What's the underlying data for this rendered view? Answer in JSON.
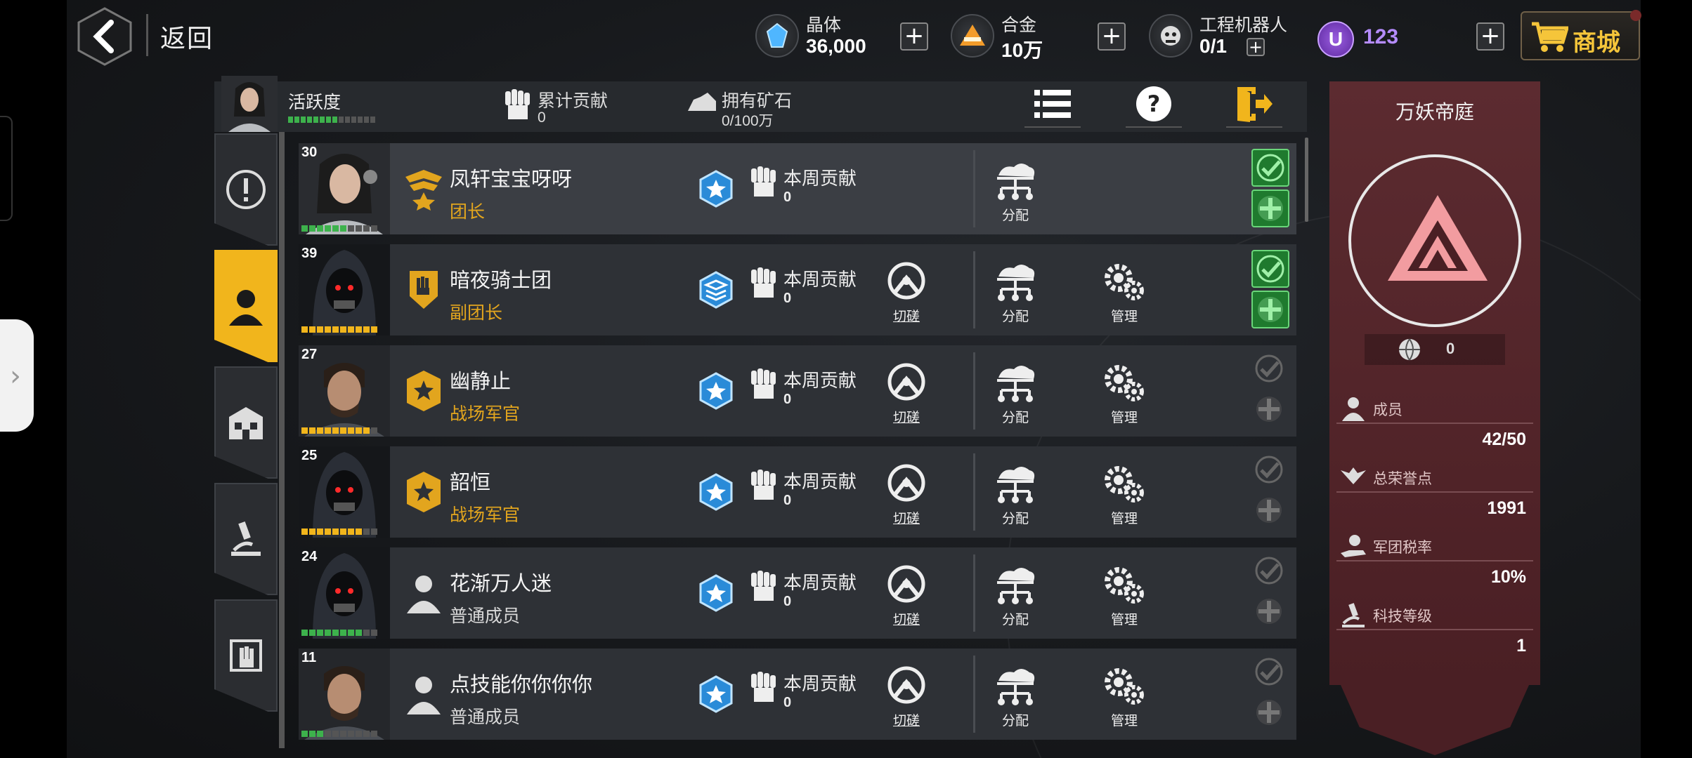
{
  "topbar": {
    "back_label": "返回",
    "crystal": {
      "name": "晶体",
      "value": "36,000"
    },
    "alloy": {
      "name": "合金",
      "value": "10万"
    },
    "robot": {
      "name": "工程机器人",
      "value": "0/1"
    },
    "u_currency": {
      "value": "123"
    },
    "shop_label": "商城"
  },
  "guild_header": {
    "activity_label": "活跃度",
    "activity_level": 0.57,
    "contribution": {
      "label": "累计贡献",
      "value": "0"
    },
    "ore": {
      "label": "拥有矿石",
      "value": "0/100万"
    }
  },
  "members": [
    {
      "level": "30",
      "name": "凤轩宝宝呀呀",
      "role": "团长",
      "weekly_label": "本周贡献",
      "weekly": "0",
      "actions": [
        "分配"
      ],
      "perms": [
        "on",
        "on"
      ],
      "bar": "g",
      "bar_fill": 0.6
    },
    {
      "level": "39",
      "name": "暗夜骑士团",
      "role": "副团长",
      "weekly_label": "本周贡献",
      "weekly": "0",
      "actions": [
        "切磋",
        "分配",
        "管理"
      ],
      "perms": [
        "on",
        "on"
      ],
      "bar": "y",
      "bar_fill": 1.0
    },
    {
      "level": "27",
      "name": "幽静止",
      "role": "战场军官",
      "weekly_label": "本周贡献",
      "weekly": "0",
      "actions": [
        "切磋",
        "分配",
        "管理"
      ],
      "perms": [
        "off",
        "off"
      ],
      "bar": "y",
      "bar_fill": 0.9
    },
    {
      "level": "25",
      "name": "韶恒",
      "role": "战场军官",
      "weekly_label": "本周贡献",
      "weekly": "0",
      "actions": [
        "切磋",
        "分配",
        "管理"
      ],
      "perms": [
        "off",
        "off"
      ],
      "bar": "y",
      "bar_fill": 0.8
    },
    {
      "level": "24",
      "name": "花渐万人迷",
      "role": "普通成员",
      "weekly_label": "本周贡献",
      "weekly": "0",
      "actions": [
        "切磋",
        "分配",
        "管理"
      ],
      "perms": [
        "off",
        "off"
      ],
      "bar": "g",
      "bar_fill": 0.8
    },
    {
      "level": "11",
      "name": "点技能你你你你",
      "role": "普通成员",
      "weekly_label": "本周贡献",
      "weekly": "0",
      "actions": [
        "切磋",
        "分配",
        "管理"
      ],
      "perms": [
        "off",
        "off"
      ],
      "bar": "g",
      "bar_fill": 0.3
    }
  ],
  "guild": {
    "name": "万妖帝庭",
    "points": "0",
    "members_label": "成员",
    "members_value": "42/50",
    "honor_label": "总荣誉点",
    "honor_value": "1991",
    "tax_label": "军团税率",
    "tax_value": "10%",
    "tech_label": "科技等级",
    "tech_value": "1"
  },
  "colors": {
    "accent": "#f1b51c",
    "perm_on": "#1f7a2e",
    "guild_banner": "#5c2b30",
    "u_currency": "#b58cff"
  }
}
